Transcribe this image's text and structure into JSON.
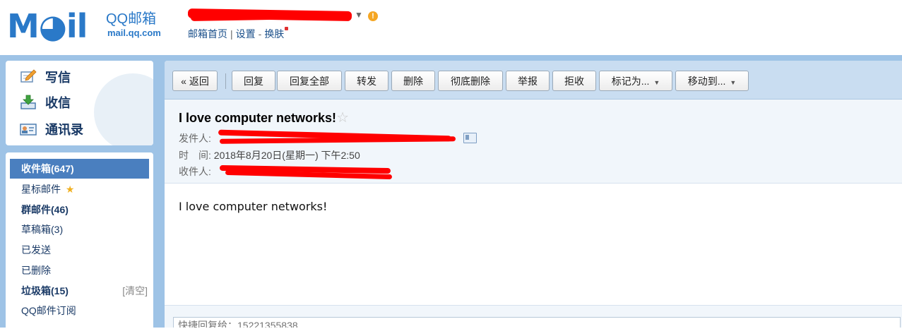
{
  "header": {
    "logo_text": "M◕il",
    "logo_brand": "QQ邮箱",
    "logo_domain": "mail.qq.com",
    "account_caret": "▼",
    "warning_icon": "!",
    "links": {
      "home": "邮箱首页",
      "divider": "|",
      "settings": "设置",
      "dash": "-",
      "skin": "换肤"
    }
  },
  "quick_actions": [
    {
      "label": "写信",
      "icon": "pencil-icon"
    },
    {
      "label": "收信",
      "icon": "inbox-download-icon"
    },
    {
      "label": "通讯录",
      "icon": "contact-card-icon"
    }
  ],
  "folders": [
    {
      "label": "收件箱(647)",
      "active": true,
      "bold": true
    },
    {
      "label": "星标邮件",
      "star": "★"
    },
    {
      "label": "群邮件(46)",
      "bold": true
    },
    {
      "label": "草稿箱(3)"
    },
    {
      "label": "已发送"
    },
    {
      "label": "已删除"
    },
    {
      "label": "垃圾箱(15)",
      "bold": true,
      "extra": "[清空]"
    },
    {
      "label": "QQ邮件订阅"
    }
  ],
  "toolbar": {
    "back": "« 返回",
    "reply": "回复",
    "reply_all": "回复全部",
    "forward": "转发",
    "delete": "删除",
    "delete_permanently": "彻底删除",
    "report": "举报",
    "reject": "拒收",
    "mark_as": "标记为...",
    "move_to": "移动到...",
    "dropdown_arrow": "▼"
  },
  "mail": {
    "subject": "I love computer networks!",
    "star": "☆",
    "from_label": "发件人:",
    "time_label": "时　间:",
    "time_value": "2018年8月20日(星期一) 下午2:50",
    "to_label": "收件人:",
    "body": "I love computer networks!"
  },
  "quick_reply": {
    "placeholder": "快捷回复给：15221355838"
  },
  "colors": {
    "brand_blue": "#2a79c8",
    "panel_blue": "#9ec3e6",
    "active_folder": "#4a7fbf",
    "redaction": "#ff0000"
  }
}
